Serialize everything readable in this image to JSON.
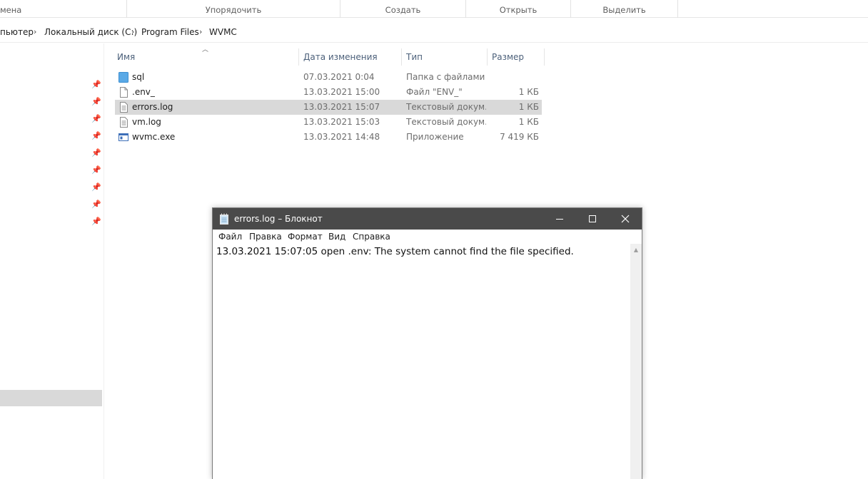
{
  "ribbon": {
    "groups": [
      "мена",
      "Упорядочить",
      "Создать",
      "Открыть",
      "Выделить"
    ]
  },
  "address": {
    "crumbs": [
      "пьютер",
      "Локальный диск (C:)",
      "Program Files",
      "WVMC"
    ]
  },
  "file_list": {
    "columns": {
      "name": "Имя",
      "date": "Дата изменения",
      "type": "Тип",
      "size": "Размер"
    },
    "rows": [
      {
        "name": "sql",
        "date": "07.03.2021 0:04",
        "type": "Папка с файлами",
        "size": "",
        "icon": "folder-icon"
      },
      {
        "name": ".env_",
        "date": "13.03.2021 15:00",
        "type": "Файл \"ENV_\"",
        "size": "1 КБ",
        "icon": "file-icon"
      },
      {
        "name": "errors.log",
        "date": "13.03.2021 15:07",
        "type": "Текстовый докум...",
        "size": "1 КБ",
        "icon": "text-file-icon",
        "selected": true
      },
      {
        "name": "vm.log",
        "date": "13.03.2021 15:03",
        "type": "Текстовый докум...",
        "size": "1 КБ",
        "icon": "text-file-icon"
      },
      {
        "name": "wvmc.exe",
        "date": "13.03.2021 14:48",
        "type": "Приложение",
        "size": "7 419 КБ",
        "icon": "exe-icon"
      }
    ]
  },
  "notepad": {
    "title": "errors.log – Блокнот",
    "menu": [
      "Файл",
      "Правка",
      "Формат",
      "Вид",
      "Справка"
    ],
    "content": "13.03.2021 15:07:05 open .env: The system cannot find the file specified."
  },
  "colors": {
    "selection": "#d9d9d9",
    "header_text": "#4c607a",
    "notepad_titlebar": "#4a4a4a",
    "folder": "#5aa9e6"
  }
}
